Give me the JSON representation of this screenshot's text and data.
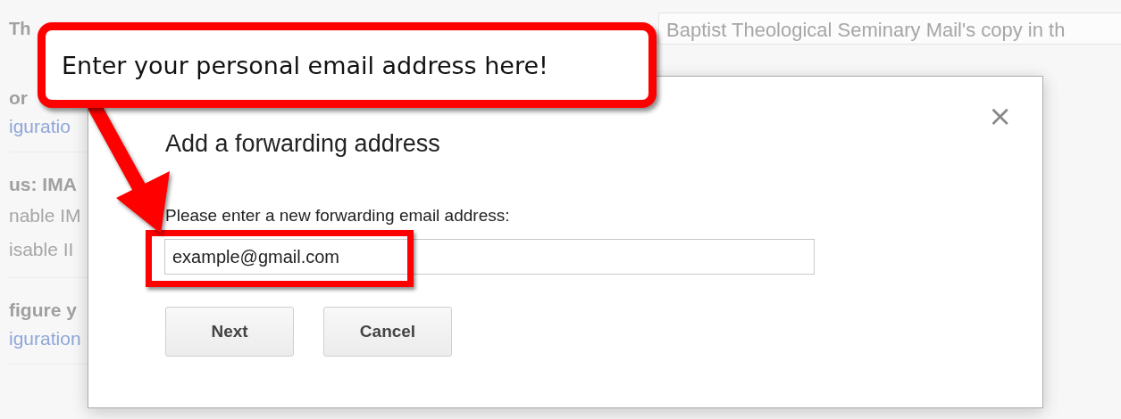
{
  "background": {
    "heading": "Th",
    "field_value": "Baptist Theological Seminary Mail's copy in th",
    "sections": [
      {
        "title": "or",
        "lines": [
          "iguratio"
        ]
      },
      {
        "title": "us: IMA",
        "lines": [
          "nable IM",
          "isable II"
        ]
      },
      {
        "title": "figure y",
        "lines": [
          "iguration"
        ]
      }
    ]
  },
  "dialog": {
    "title": "Add a forwarding address",
    "close": "×",
    "prompt": "Please enter a new forwarding email address:",
    "value": "example@gmail.com",
    "buttons": [
      "Next",
      "Cancel"
    ]
  },
  "callout": {
    "text": "Enter your personal email address here!"
  }
}
